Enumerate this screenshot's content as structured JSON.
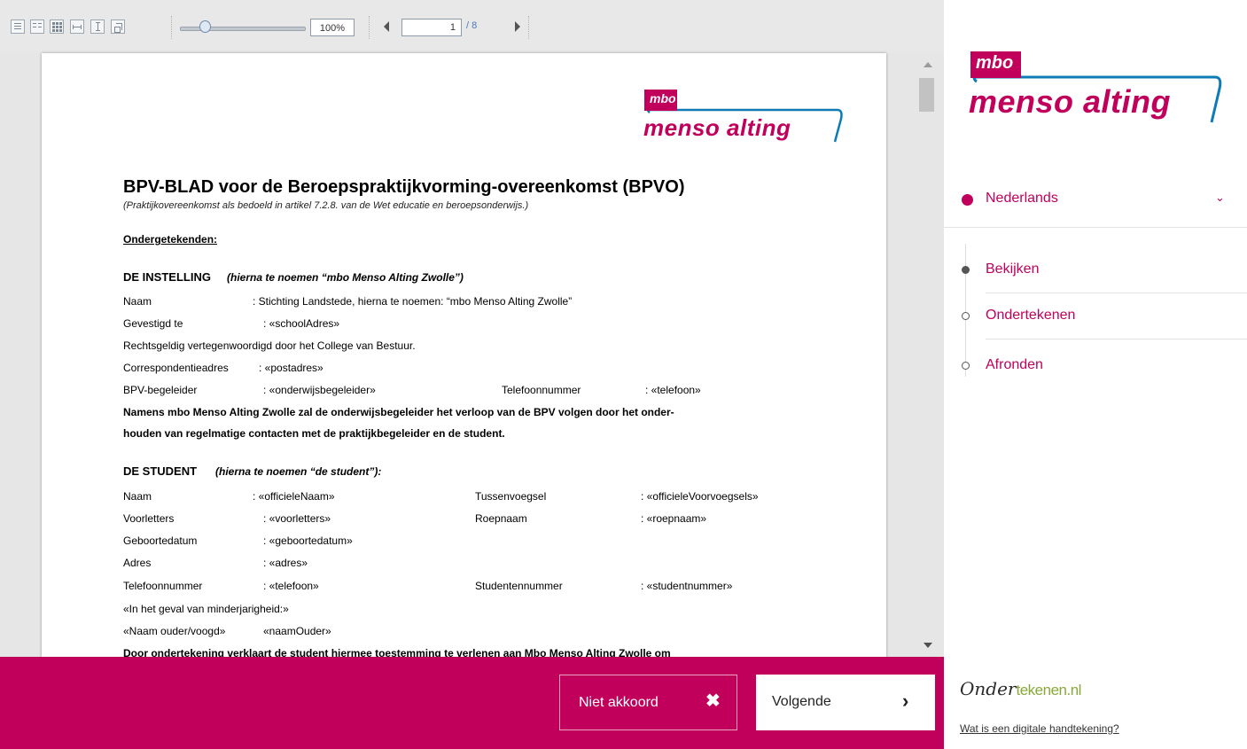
{
  "toolbar": {
    "zoom_value": "100%",
    "page_input": "1",
    "page_total": "/ 8"
  },
  "document": {
    "logo": {
      "small": "mbo",
      "large": "menso alting"
    },
    "title": "BPV-BLAD voor de Beroepspraktijkvorming-overeenkomst (BPVO)",
    "subtitle": "(Praktijkovereenkomst als bedoeld in artikel 7.2.8. van de Wet educatie en beroepsonderwijs.)",
    "undersigned": "Ondergetekenden:",
    "institution_heading": "DE INSTELLING",
    "institution_heading_note": "(hierna te noemen “mbo Menso Alting Zwolle”)",
    "institution_fields": [
      {
        "label": "Naam",
        "value": ": Stichting Landstede, hierna te noemen: “mbo Menso Alting Zwolle”"
      },
      {
        "label": "Gevestigd te",
        "value": ": «schoolAdres»"
      }
    ],
    "representation": "Rechtsgeldig vertegenwoordigd door het College van Bestuur.",
    "correspondence_label": "Correspondentieadres",
    "correspondence_value": ": «postadres»",
    "bpv_label": "BPV-begeleider",
    "bpv_value": ": «onderwijsbegeleider»",
    "phone_label": "Telefoonnummer",
    "phone_value": ": «telefoon»",
    "bold_para_1": "Namens mbo Menso Alting Zwolle zal de onderwijsbegeleider het verloop van de BPV volgen door het onder-",
    "bold_para_2": "houden van regelmatige contacten met de praktijkbegeleider en de student.",
    "student_heading": "DE STUDENT",
    "student_heading_note": "(hierna te noemen “de student”):",
    "student_rows": [
      {
        "l1": "Naam",
        "v1": ": «officieleNaam»",
        "l2": "Tussenvoegsel",
        "v2": ": «officieleVoorvoegsels»"
      },
      {
        "l1": "Voorletters",
        "v1": ": «voorletters»",
        "l2": "Roepnaam",
        "v2": ": «roepnaam»"
      },
      {
        "l1": "Geboortedatum",
        "v1": ": «geboortedatum»",
        "l2": "",
        "v2": ""
      },
      {
        "l1": "Adres",
        "v1": ": «adres»",
        "l2": "",
        "v2": ""
      },
      {
        "l1": "Telefoonnummer",
        "v1": ": «telefoon»",
        "l2": "Studentennummer",
        "v2": ": «studentnummer»"
      }
    ],
    "minor_line": "«In het geval van minderjarigheid:»",
    "guardian_label": "«Naam ouder/voogd»",
    "guardian_value": "«naamOuder»",
    "cut_line": "Door ondertekening verklaart de student hiermee toestemming te verlenen aan Mbo Menso Alting Zwolle om"
  },
  "actions": {
    "decline_label": "Niet akkoord",
    "decline_icon": "✖",
    "next_label": "Volgende",
    "next_icon": "›"
  },
  "sidebar": {
    "logo": {
      "small": "mbo",
      "large": "menso alting"
    },
    "language": "Nederlands",
    "steps": [
      {
        "label": "Bekijken",
        "active": true
      },
      {
        "label": "Ondertekenen",
        "active": false
      },
      {
        "label": "Afronden",
        "active": false
      }
    ],
    "footer_logo_dark": "Onder",
    "footer_logo_green": "tekenen.nl",
    "footer_link": "Wat is een digitale handtekening?"
  },
  "colors": {
    "brand": "#c0005b",
    "brand_blue": "#0d7bb5"
  }
}
